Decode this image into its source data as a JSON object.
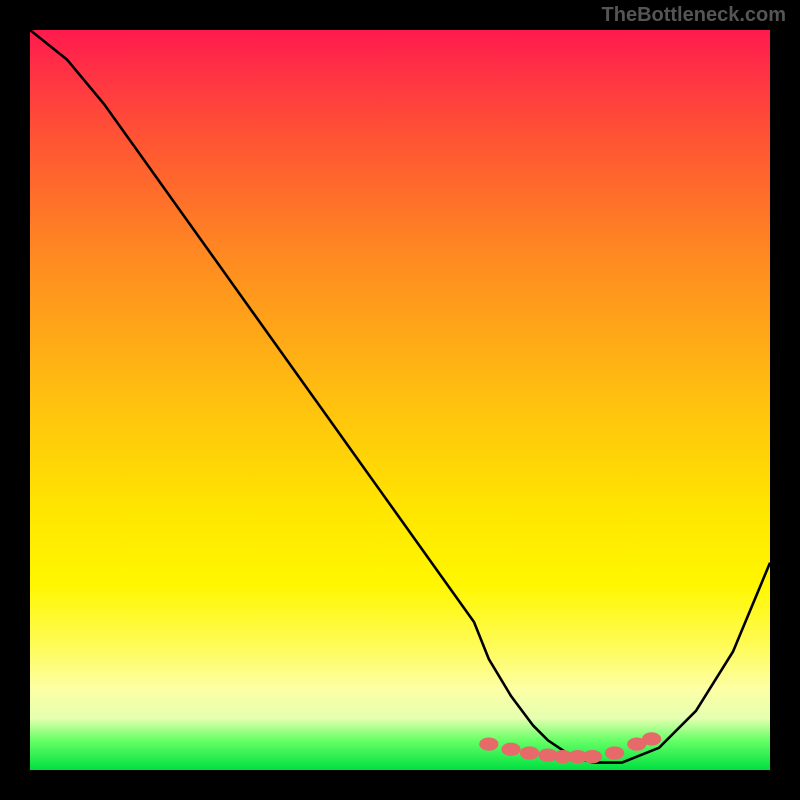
{
  "watermark": "TheBottleneck.com",
  "chart_data": {
    "type": "line",
    "title": "",
    "xlabel": "",
    "ylabel": "",
    "xlim": [
      0,
      100
    ],
    "ylim": [
      0,
      100
    ],
    "series": [
      {
        "name": "curve",
        "x": [
          0,
          5,
          10,
          15,
          20,
          25,
          30,
          35,
          40,
          45,
          50,
          55,
          60,
          62,
          65,
          68,
          70,
          73,
          76,
          80,
          85,
          90,
          95,
          100
        ],
        "y": [
          100,
          96,
          90,
          83,
          76,
          69,
          62,
          55,
          48,
          41,
          34,
          27,
          20,
          15,
          10,
          6,
          4,
          2,
          1,
          1,
          3,
          8,
          16,
          28
        ],
        "color": "#000000"
      },
      {
        "name": "markers",
        "type": "scatter",
        "x": [
          62,
          65,
          67.5,
          70,
          72,
          74,
          76,
          79,
          82,
          84
        ],
        "y": [
          3.5,
          2.8,
          2.3,
          2.0,
          1.8,
          1.8,
          1.8,
          2.3,
          3.5,
          4.2
        ],
        "color": "#e66a6a"
      }
    ]
  }
}
